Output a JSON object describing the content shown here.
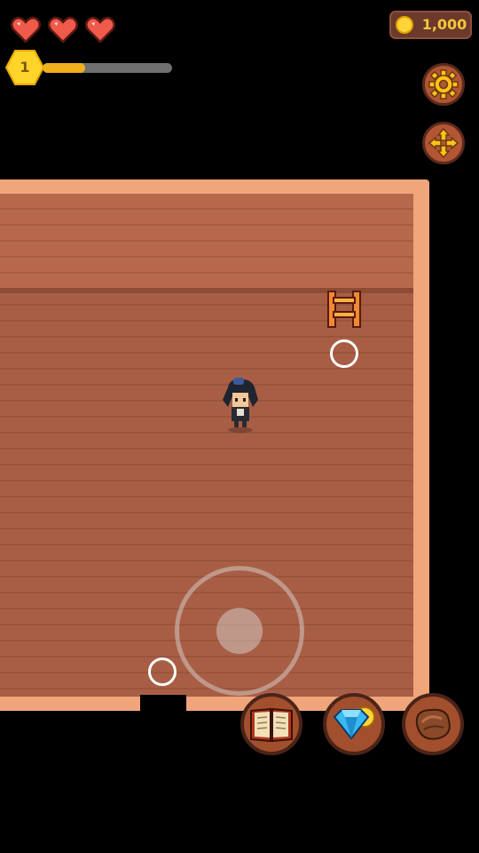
{
  "hud": {
    "hearts": {
      "current": 3,
      "max": 3,
      "icon": "heart-icon",
      "color": "#f05a4a"
    },
    "level": {
      "value": "1",
      "color": "#ffd42a"
    },
    "xp": {
      "progress": 0.33,
      "color": "#f2b01c"
    },
    "coins": {
      "value": "1,000",
      "icon": "coin-icon"
    }
  },
  "buttons": {
    "settings": {
      "icon": "gear-icon"
    },
    "move": {
      "icon": "move-arrows-icon"
    },
    "book": {
      "icon": "book-icon"
    },
    "shop": {
      "icon": "gem-coin-icon"
    },
    "inventory": {
      "icon": "leather-bag-icon"
    }
  },
  "colors": {
    "room_border": "#f0a57a",
    "floor": "#a85e45",
    "button_bg": "#b35633"
  }
}
